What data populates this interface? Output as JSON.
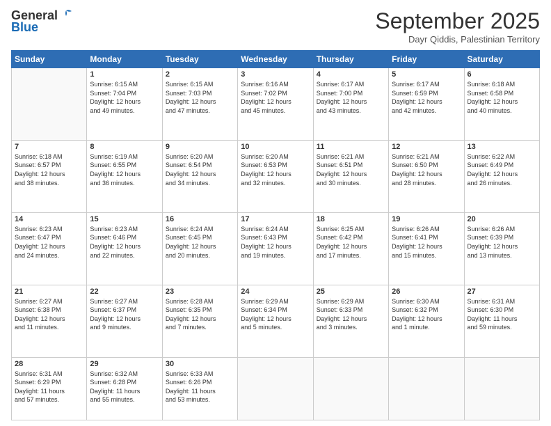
{
  "logo": {
    "general": "General",
    "blue": "Blue"
  },
  "header": {
    "month_title": "September 2025",
    "subtitle": "Dayr Qiddis, Palestinian Territory"
  },
  "days_of_week": [
    "Sunday",
    "Monday",
    "Tuesday",
    "Wednesday",
    "Thursday",
    "Friday",
    "Saturday"
  ],
  "weeks": [
    [
      {
        "day": "",
        "info": ""
      },
      {
        "day": "1",
        "info": "Sunrise: 6:15 AM\nSunset: 7:04 PM\nDaylight: 12 hours\nand 49 minutes."
      },
      {
        "day": "2",
        "info": "Sunrise: 6:15 AM\nSunset: 7:03 PM\nDaylight: 12 hours\nand 47 minutes."
      },
      {
        "day": "3",
        "info": "Sunrise: 6:16 AM\nSunset: 7:02 PM\nDaylight: 12 hours\nand 45 minutes."
      },
      {
        "day": "4",
        "info": "Sunrise: 6:17 AM\nSunset: 7:00 PM\nDaylight: 12 hours\nand 43 minutes."
      },
      {
        "day": "5",
        "info": "Sunrise: 6:17 AM\nSunset: 6:59 PM\nDaylight: 12 hours\nand 42 minutes."
      },
      {
        "day": "6",
        "info": "Sunrise: 6:18 AM\nSunset: 6:58 PM\nDaylight: 12 hours\nand 40 minutes."
      }
    ],
    [
      {
        "day": "7",
        "info": "Sunrise: 6:18 AM\nSunset: 6:57 PM\nDaylight: 12 hours\nand 38 minutes."
      },
      {
        "day": "8",
        "info": "Sunrise: 6:19 AM\nSunset: 6:55 PM\nDaylight: 12 hours\nand 36 minutes."
      },
      {
        "day": "9",
        "info": "Sunrise: 6:20 AM\nSunset: 6:54 PM\nDaylight: 12 hours\nand 34 minutes."
      },
      {
        "day": "10",
        "info": "Sunrise: 6:20 AM\nSunset: 6:53 PM\nDaylight: 12 hours\nand 32 minutes."
      },
      {
        "day": "11",
        "info": "Sunrise: 6:21 AM\nSunset: 6:51 PM\nDaylight: 12 hours\nand 30 minutes."
      },
      {
        "day": "12",
        "info": "Sunrise: 6:21 AM\nSunset: 6:50 PM\nDaylight: 12 hours\nand 28 minutes."
      },
      {
        "day": "13",
        "info": "Sunrise: 6:22 AM\nSunset: 6:49 PM\nDaylight: 12 hours\nand 26 minutes."
      }
    ],
    [
      {
        "day": "14",
        "info": "Sunrise: 6:23 AM\nSunset: 6:47 PM\nDaylight: 12 hours\nand 24 minutes."
      },
      {
        "day": "15",
        "info": "Sunrise: 6:23 AM\nSunset: 6:46 PM\nDaylight: 12 hours\nand 22 minutes."
      },
      {
        "day": "16",
        "info": "Sunrise: 6:24 AM\nSunset: 6:45 PM\nDaylight: 12 hours\nand 20 minutes."
      },
      {
        "day": "17",
        "info": "Sunrise: 6:24 AM\nSunset: 6:43 PM\nDaylight: 12 hours\nand 19 minutes."
      },
      {
        "day": "18",
        "info": "Sunrise: 6:25 AM\nSunset: 6:42 PM\nDaylight: 12 hours\nand 17 minutes."
      },
      {
        "day": "19",
        "info": "Sunrise: 6:26 AM\nSunset: 6:41 PM\nDaylight: 12 hours\nand 15 minutes."
      },
      {
        "day": "20",
        "info": "Sunrise: 6:26 AM\nSunset: 6:39 PM\nDaylight: 12 hours\nand 13 minutes."
      }
    ],
    [
      {
        "day": "21",
        "info": "Sunrise: 6:27 AM\nSunset: 6:38 PM\nDaylight: 12 hours\nand 11 minutes."
      },
      {
        "day": "22",
        "info": "Sunrise: 6:27 AM\nSunset: 6:37 PM\nDaylight: 12 hours\nand 9 minutes."
      },
      {
        "day": "23",
        "info": "Sunrise: 6:28 AM\nSunset: 6:35 PM\nDaylight: 12 hours\nand 7 minutes."
      },
      {
        "day": "24",
        "info": "Sunrise: 6:29 AM\nSunset: 6:34 PM\nDaylight: 12 hours\nand 5 minutes."
      },
      {
        "day": "25",
        "info": "Sunrise: 6:29 AM\nSunset: 6:33 PM\nDaylight: 12 hours\nand 3 minutes."
      },
      {
        "day": "26",
        "info": "Sunrise: 6:30 AM\nSunset: 6:32 PM\nDaylight: 12 hours\nand 1 minute."
      },
      {
        "day": "27",
        "info": "Sunrise: 6:31 AM\nSunset: 6:30 PM\nDaylight: 11 hours\nand 59 minutes."
      }
    ],
    [
      {
        "day": "28",
        "info": "Sunrise: 6:31 AM\nSunset: 6:29 PM\nDaylight: 11 hours\nand 57 minutes."
      },
      {
        "day": "29",
        "info": "Sunrise: 6:32 AM\nSunset: 6:28 PM\nDaylight: 11 hours\nand 55 minutes."
      },
      {
        "day": "30",
        "info": "Sunrise: 6:33 AM\nSunset: 6:26 PM\nDaylight: 11 hours\nand 53 minutes."
      },
      {
        "day": "",
        "info": ""
      },
      {
        "day": "",
        "info": ""
      },
      {
        "day": "",
        "info": ""
      },
      {
        "day": "",
        "info": ""
      }
    ]
  ]
}
